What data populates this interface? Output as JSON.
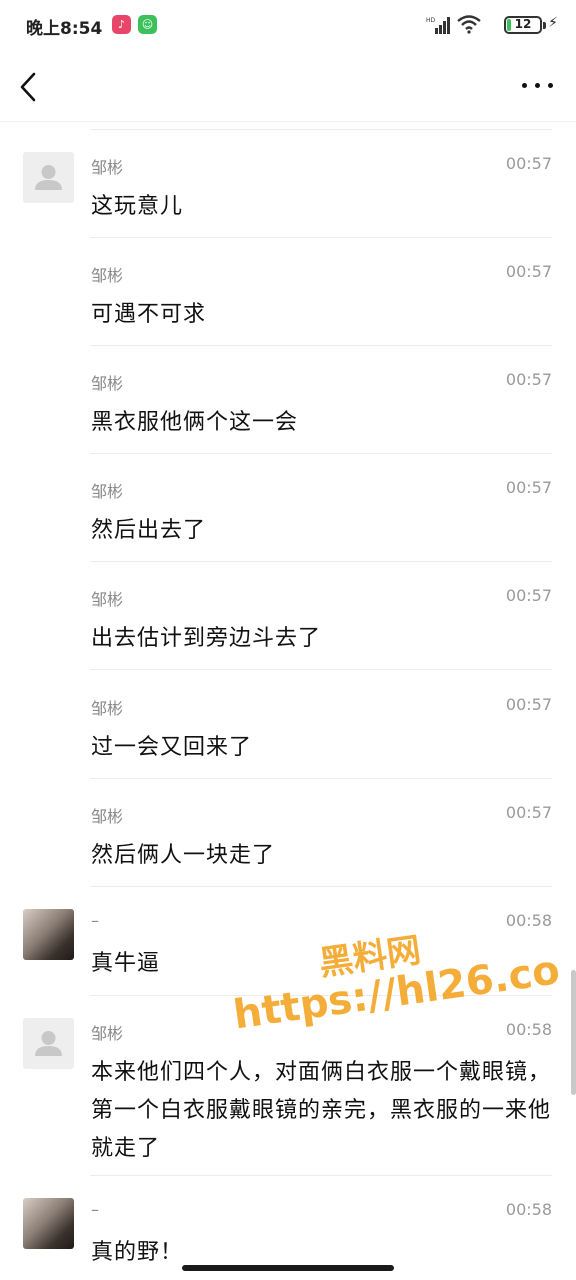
{
  "status_bar": {
    "time": "晚上8:54",
    "network_label": "HD",
    "battery_level": "12"
  },
  "nav": {
    "back_icon": "chevron-left-icon",
    "more_icon": "more-horizontal-icon"
  },
  "messages": [
    {
      "sender": "邹彬",
      "time": "00:57",
      "text": "这玩意儿",
      "avatar": "default-avatar"
    },
    {
      "sender": "邹彬",
      "time": "00:57",
      "text": "可遇不可求"
    },
    {
      "sender": "邹彬",
      "time": "00:57",
      "text": "黑衣服他俩个这一会"
    },
    {
      "sender": "邹彬",
      "time": "00:57",
      "text": "然后出去了"
    },
    {
      "sender": "邹彬",
      "time": "00:57",
      "text": "出去估计到旁边斗去了"
    },
    {
      "sender": "邹彬",
      "time": "00:57",
      "text": "过一会又回来了"
    },
    {
      "sender": "邹彬",
      "time": "00:57",
      "text": "然后俩人一块走了"
    },
    {
      "sender": "–",
      "time": "00:58",
      "text": "真牛逼",
      "avatar": "photo-avatar"
    },
    {
      "sender": "邹彬",
      "time": "00:58",
      "text": "本来他们四个人，对面俩白衣服一个戴眼镜，第一个白衣服戴眼镜的亲完，黑衣服的一来他就走了",
      "avatar": "default-avatar"
    },
    {
      "sender": "–",
      "time": "00:58",
      "text": "真的野！",
      "avatar": "photo-avatar"
    }
  ],
  "watermark": {
    "line1": "黑料网",
    "line2": "https://hl26.co"
  }
}
